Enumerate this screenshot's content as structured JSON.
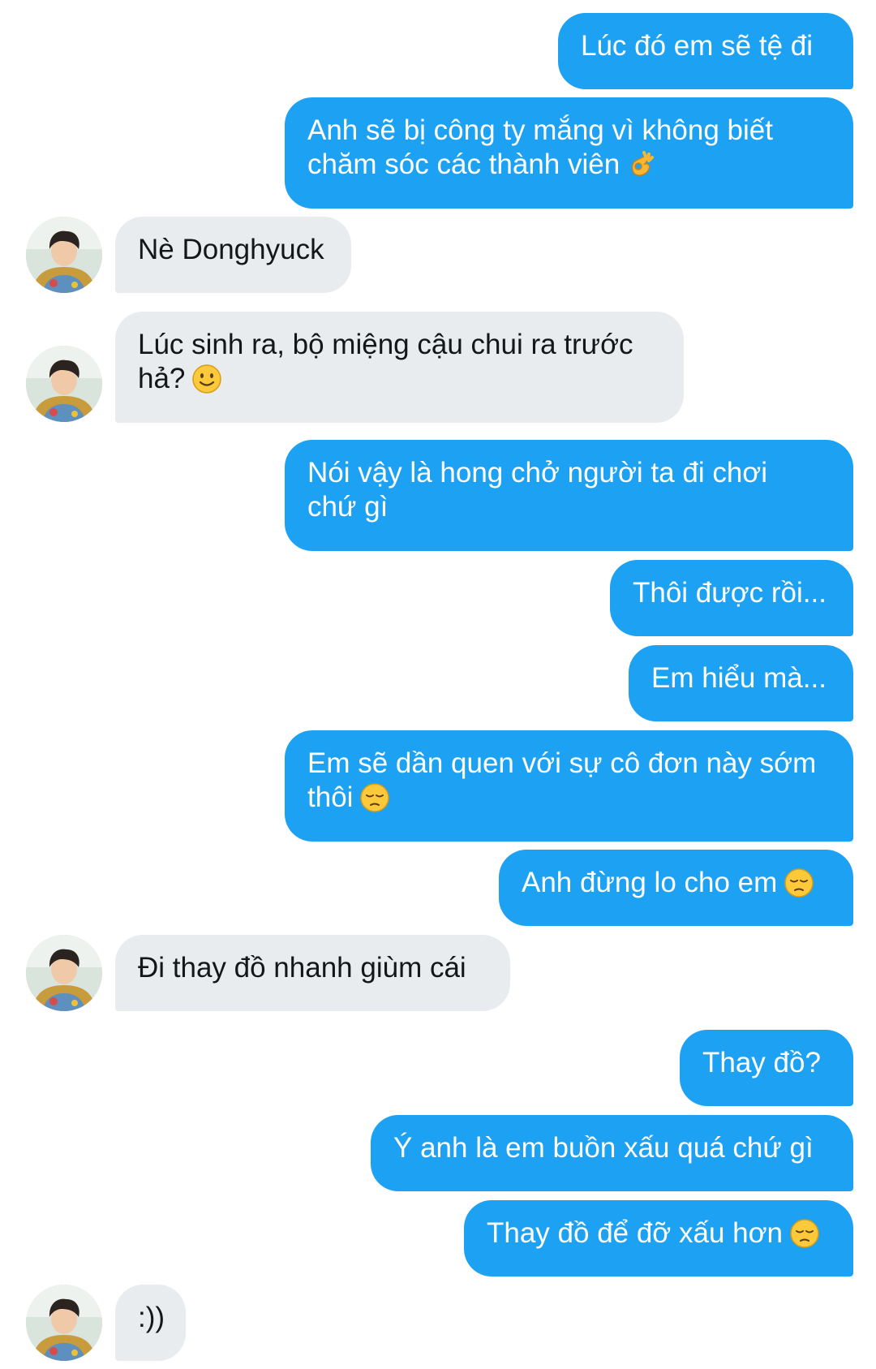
{
  "conversation": {
    "messages": [
      {
        "side": "out",
        "lines": [
          "Lúc đó em sẽ tệ đi"
        ]
      },
      {
        "side": "out",
        "lines": [
          "Anh sẽ bị công ty mắng vì không biết",
          "chăm sóc các thành viên"
        ],
        "emoji": "ok-hand-emoji"
      },
      {
        "side": "in",
        "lines": [
          "Nè Donghyuck"
        ]
      },
      {
        "side": "in",
        "lines": [
          "Lúc sinh ra, bộ miệng cậu chui ra trước",
          "hả?"
        ],
        "emoji": "slight-smile-emoji"
      },
      {
        "side": "out",
        "lines": [
          "Nói vậy là hong chở người ta đi chơi",
          "chứ gì"
        ]
      },
      {
        "side": "out",
        "lines": [
          "Thôi được rồi..."
        ]
      },
      {
        "side": "out",
        "lines": [
          "Em hiểu mà..."
        ]
      },
      {
        "side": "out",
        "lines": [
          "Em sẽ dần quen với sự cô đơn này sớm",
          "thôi"
        ],
        "emoji": "pensive-face-emoji"
      },
      {
        "side": "out",
        "lines": [
          "Anh đừng lo cho em"
        ],
        "emoji": "pensive-face-emoji"
      },
      {
        "side": "in",
        "lines": [
          "Đi thay đồ nhanh giùm cái"
        ]
      },
      {
        "side": "out",
        "lines": [
          "Thay đồ?"
        ]
      },
      {
        "side": "out",
        "lines": [
          "Ý anh là em buồn xấu quá chứ gì"
        ]
      },
      {
        "side": "out",
        "lines": [
          "Thay đồ để đỡ xấu hơn"
        ],
        "emoji": "pensive-face-emoji"
      },
      {
        "side": "in",
        "lines": [
          ":))"
        ]
      }
    ]
  },
  "colors": {
    "outgoing_bubble": "#1da1f2",
    "incoming_bubble": "#e9ecef",
    "outgoing_text": "#ffffff",
    "incoming_text": "#14171a"
  },
  "icons": {
    "avatar": "avatar-photo",
    "emoji_set": [
      "ok-hand-emoji",
      "slight-smile-emoji",
      "pensive-face-emoji"
    ]
  }
}
